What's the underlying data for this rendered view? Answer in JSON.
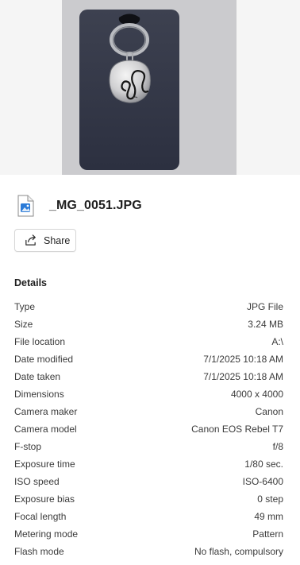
{
  "file": {
    "name": "_MG_0051.JPG",
    "icon": "image-file-icon"
  },
  "actions": {
    "share_label": "Share"
  },
  "details": {
    "title": "Details",
    "rows": [
      {
        "label": "Type",
        "value": "JPG File"
      },
      {
        "label": "Size",
        "value": "3.24 MB"
      },
      {
        "label": "File location",
        "value": "A:\\"
      },
      {
        "label": "Date modified",
        "value": "7/1/2025 10:18 AM"
      },
      {
        "label": "Date taken",
        "value": "7/1/2025 10:18 AM"
      },
      {
        "label": "Dimensions",
        "value": "4000 x 4000"
      },
      {
        "label": "Camera maker",
        "value": "Canon"
      },
      {
        "label": "Camera model",
        "value": "Canon EOS Rebel T7"
      },
      {
        "label": "F-stop",
        "value": "f/8"
      },
      {
        "label": "Exposure time",
        "value": "1/80 sec."
      },
      {
        "label": "ISO speed",
        "value": "ISO-6400"
      },
      {
        "label": "Exposure bias",
        "value": "0 step"
      },
      {
        "label": "Focal length",
        "value": "49 mm"
      },
      {
        "label": "Metering mode",
        "value": "Pattern"
      },
      {
        "label": "Flash mode",
        "value": "No flash, compulsory"
      }
    ]
  }
}
